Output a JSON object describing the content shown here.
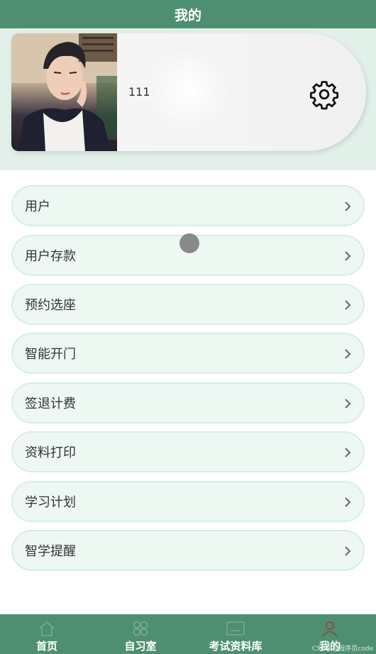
{
  "header": {
    "title": "我的"
  },
  "profile": {
    "username": "111"
  },
  "icons": {
    "settings": "gear-icon",
    "chevron": "chevron-right-icon"
  },
  "menu": {
    "items": [
      {
        "label": "用户"
      },
      {
        "label": "用户存款"
      },
      {
        "label": "预约选座"
      },
      {
        "label": "智能开门"
      },
      {
        "label": "签退计费"
      },
      {
        "label": "资料打印"
      },
      {
        "label": "学习计划"
      },
      {
        "label": "智学提醒"
      }
    ]
  },
  "tabbar": {
    "tabs": [
      {
        "label": "首页",
        "icon": "home-icon"
      },
      {
        "label": "自习室",
        "icon": "grid-flower-icon"
      },
      {
        "label": "考试资料库",
        "icon": "screen-icon"
      },
      {
        "label": "我的",
        "icon": "user-icon"
      }
    ],
    "active_index": 3
  },
  "watermark": {
    "text": "CSDN @程序员code"
  },
  "colors": {
    "brand": "#4d8f70",
    "menu_bg": "#edf8f3",
    "menu_border": "#d6eee3",
    "profile_zone_bg": "#e1f1ea",
    "active_tab_icon": "#8a4b3c"
  }
}
